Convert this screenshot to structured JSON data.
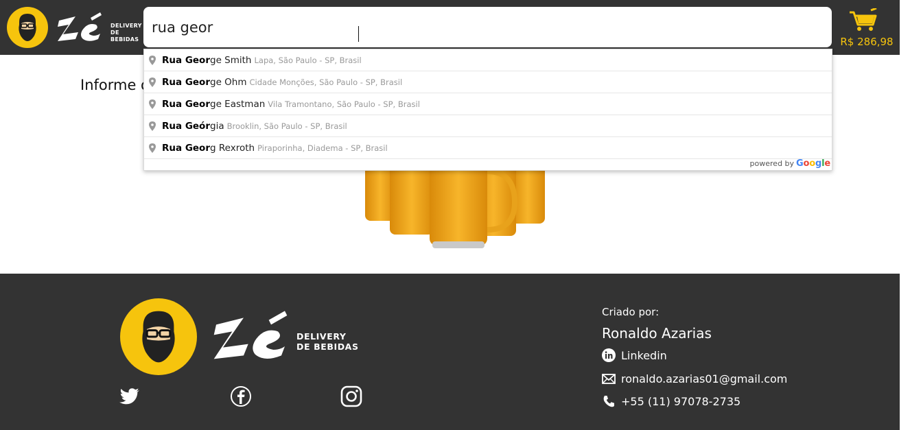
{
  "brand": {
    "logo_text": "Zé",
    "subtitle_line1": "DELIVERY",
    "subtitle_line2": "DE BEBIDAS",
    "primary_color": "#f6c40d",
    "dark_color": "#333333"
  },
  "search": {
    "value": "rua geor",
    "placeholder": ""
  },
  "cart": {
    "icon": "shopping-cart-icon",
    "total": "R$ 286,98"
  },
  "main": {
    "title": "Informe o"
  },
  "autocomplete": {
    "suggestions": [
      {
        "match": "Rua Geor",
        "rest": "ge Smith",
        "secondary": "Lapa, São Paulo - SP, Brasil"
      },
      {
        "match": "Rua Geor",
        "rest": "ge Ohm",
        "secondary": "Cidade Monções, São Paulo - SP, Brasil"
      },
      {
        "match": "Rua Geor",
        "rest": "ge Eastman",
        "secondary": "Vila Tramontano, São Paulo - SP, Brasil"
      },
      {
        "match": "Rua Geór",
        "rest": "gia",
        "secondary": "Brooklin, São Paulo - SP, Brasil"
      },
      {
        "match": "Rua Geor",
        "rest": "g Rexroth",
        "secondary": "Piraporinha, Diadema - SP, Brasil"
      }
    ],
    "powered_by": "powered by",
    "google": "Google"
  },
  "footer": {
    "social": [
      "twitter-icon",
      "facebook-icon",
      "instagram-icon"
    ],
    "criado_label": "Criado por:",
    "author": "Ronaldo Azarias",
    "linkedin_label": "Linkedin",
    "email": "ronaldo.azarias01@gmail.com",
    "phone": "+55 (11) 97078-2735"
  }
}
